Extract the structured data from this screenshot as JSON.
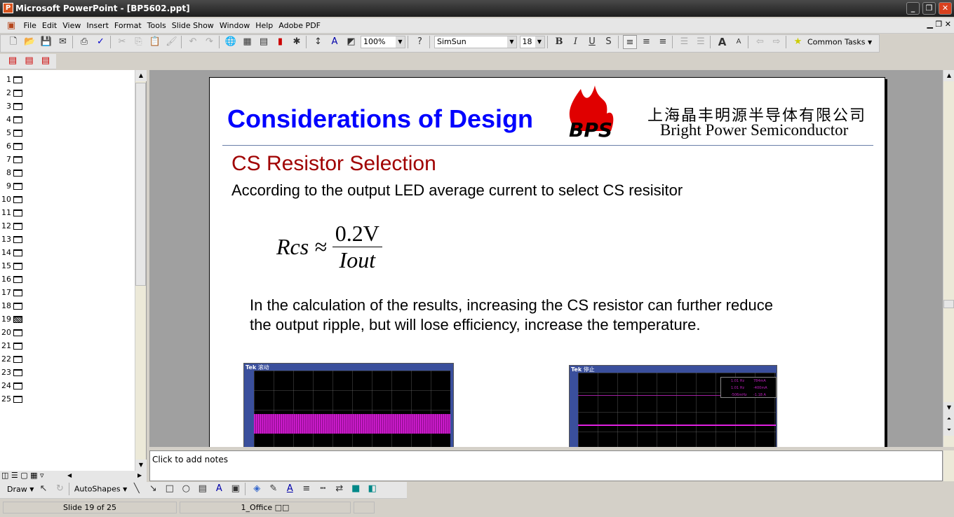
{
  "window": {
    "title": "Microsoft PowerPoint - [BP5602.ppt]"
  },
  "menu": [
    "File",
    "Edit",
    "View",
    "Insert",
    "Format",
    "Tools",
    "Slide Show",
    "Window",
    "Help",
    "Adobe PDF"
  ],
  "toolbar": {
    "zoom": "100%",
    "font": "SimSun",
    "font_size": "18",
    "common_tasks": "Common Tasks"
  },
  "slides": [
    "1",
    "2",
    "3",
    "4",
    "5",
    "6",
    "7",
    "8",
    "9",
    "10",
    "11",
    "12",
    "13",
    "14",
    "15",
    "16",
    "17",
    "18",
    "19",
    "20",
    "21",
    "22",
    "23",
    "24",
    "25"
  ],
  "selected_slide": "19",
  "slide": {
    "title": "Considerations of Design",
    "logo_cn": "上海晶丰明源半导体有限公司",
    "logo_en": "Bright Power Semiconductor",
    "logo_mark": "BPS",
    "subtitle": "CS Resistor Selection",
    "line1": "According to the output LED average current to select CS resisitor",
    "formula": {
      "lhs": "Rcs ≈",
      "num": "0.2V",
      "den": "Iout"
    },
    "para1": "In the calculation of the results, increasing the CS resistor can further reduce",
    "para2": "the output ripple, but will lose efficiency, increase the temperature.",
    "scope1": {
      "brand": "Tek",
      "status": "滚动"
    },
    "scope2": {
      "brand": "Tek",
      "status": "停止",
      "readouts": [
        "1.01 Hz",
        "784mA",
        "1.01 Hz",
        "-400mA",
        "-506mHz",
        "-1.18 A"
      ]
    }
  },
  "notes": {
    "placeholder": "Click to add notes"
  },
  "drawbar": {
    "draw": "Draw",
    "autoshapes": "AutoShapes"
  },
  "status": {
    "slide": "Slide 19 of 25",
    "design": "1_Office □□"
  }
}
